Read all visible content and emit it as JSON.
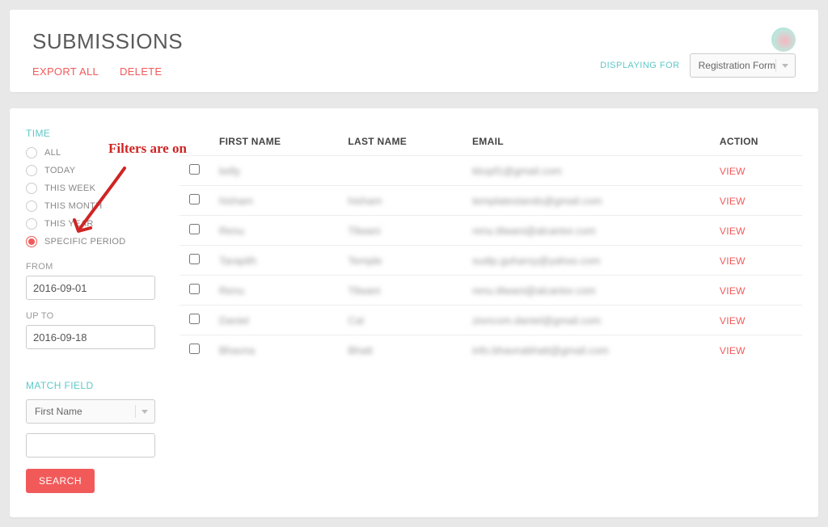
{
  "header": {
    "title": "SUBMISSIONS",
    "export_label": "EXPORT ALL",
    "delete_label": "DELETE",
    "displaying_for_label": "DISPLAYING FOR",
    "form_select_value": "Registration Form"
  },
  "sidebar": {
    "time_label": "TIME",
    "radio_options": [
      {
        "label": "ALL",
        "selected": false
      },
      {
        "label": "TODAY",
        "selected": false
      },
      {
        "label": "THIS WEEK",
        "selected": false
      },
      {
        "label": "THIS MONTH",
        "selected": false
      },
      {
        "label": "THIS YEAR",
        "selected": false
      },
      {
        "label": "SPECIFIC PERIOD",
        "selected": true
      }
    ],
    "from_label": "FROM",
    "from_value": "2016-09-01",
    "upto_label": "UP TO",
    "upto_value": "2016-09-18",
    "match_field_label": "MATCH FIELD",
    "match_field_value": "First Name",
    "match_query_value": "",
    "search_label": "SEARCH"
  },
  "table": {
    "columns": {
      "first_name": "FIRST NAME",
      "last_name": "LAST NAME",
      "email": "EMAIL",
      "action": "ACTION"
    },
    "action_label": "VIEW",
    "rows": [
      {
        "first_name": "kelly",
        "last_name": "",
        "email": "kkopf1@gmail.com"
      },
      {
        "first_name": "hisham",
        "last_name": "hisham",
        "email": "templatestands@gmail.com"
      },
      {
        "first_name": "Renu",
        "last_name": "Tilwani",
        "email": "renu.tilwani@alcantor.com"
      },
      {
        "first_name": "Tarapith",
        "last_name": "Temple",
        "email": "sudip.guharoy@yahoo.com"
      },
      {
        "first_name": "Renu",
        "last_name": "Tilwani",
        "email": "renu.tilwani@alcantor.com"
      },
      {
        "first_name": "Daniel",
        "last_name": "Cal",
        "email": "zioncom.daniel@gmail.com"
      },
      {
        "first_name": "Bhavna",
        "last_name": "Bhatt",
        "email": "info.bhavnabhatt@gmail.com"
      }
    ]
  },
  "annotation": {
    "text": "Filters are on"
  }
}
